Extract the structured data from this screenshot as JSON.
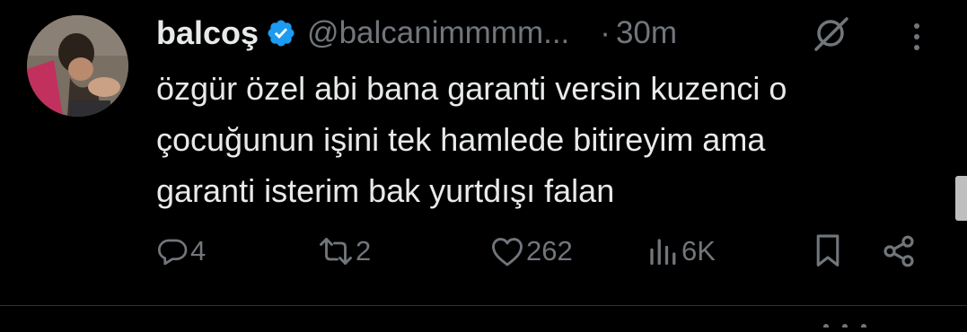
{
  "tweet": {
    "display_name": "balcoş",
    "handle": "@balcanimmmm...",
    "separator": "·",
    "time": "30m",
    "verified": true,
    "lines": [
      "özgür özel abi bana garanti versin kuzenci o",
      "çocuğunun işini tek hamlede bitireyim ama",
      "garanti isterim bak yurtdışı falan"
    ],
    "actions": {
      "replies": "4",
      "reposts": "2",
      "likes": "262",
      "views": "6K"
    }
  },
  "icons": {
    "verified": "verified-badge-icon",
    "grok": "grok-icon",
    "more": "more-options-icon",
    "reply": "reply-icon",
    "repost": "repost-icon",
    "like": "heart-icon",
    "views": "views-chart-icon",
    "bookmark": "bookmark-icon",
    "share": "share-icon"
  },
  "colors": {
    "background": "#000000",
    "text": "#e7e9ea",
    "muted": "#71767b",
    "verified": "#1d9bf0"
  }
}
